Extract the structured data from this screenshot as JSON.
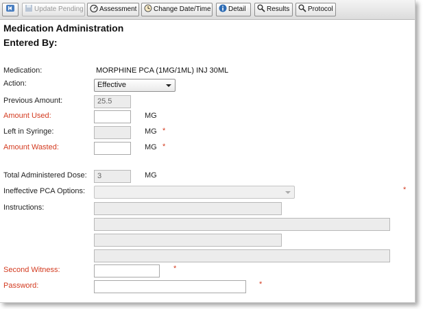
{
  "toolbar": {
    "back_label": "",
    "update_pending_label": "Update Pending",
    "assessment_label": "Assessment",
    "change_datetime_label": "Change Date/Time",
    "detail_label": "Detail",
    "results_label": "Results",
    "protocol_label": "Protocol"
  },
  "header": {
    "title": "Medication Administration",
    "entered_by": "Entered By:"
  },
  "form": {
    "medication_label": "Medication:",
    "medication_value": "MORPHINE PCA (1MG/1ML) INJ 30ML",
    "action_label": "Action:",
    "action_value": "Effective",
    "previous_amount_label": "Previous Amount:",
    "previous_amount_value": "25.5",
    "amount_used_label": "Amount Used:",
    "amount_used_value": "",
    "amount_used_unit": "MG",
    "left_in_syringe_label": "Left in Syringe:",
    "left_in_syringe_value": "",
    "left_in_syringe_unit": "MG",
    "amount_wasted_label": "Amount Wasted:",
    "amount_wasted_value": "",
    "amount_wasted_unit": "MG",
    "total_dose_label": "Total Administered Dose:",
    "total_dose_value": "3",
    "total_dose_unit": "MG",
    "ineffective_label": "Ineffective PCA Options:",
    "ineffective_value": "",
    "instructions_label": "Instructions:",
    "second_witness_label": "Second Witness:",
    "second_witness_value": "",
    "password_label": "Password:",
    "password_value": "",
    "required_mark": "*"
  },
  "colors": {
    "required": "#d33a1f",
    "readonly_field": "#ececec"
  }
}
